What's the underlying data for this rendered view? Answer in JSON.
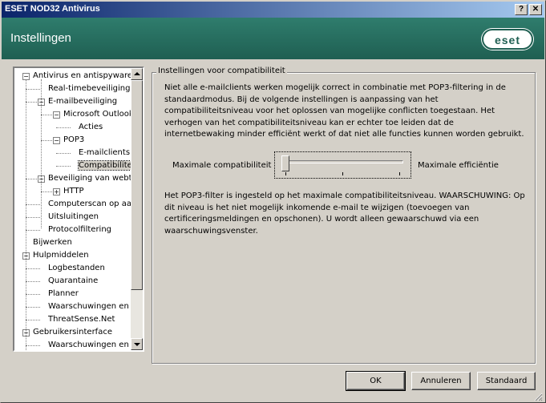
{
  "window": {
    "title": "ESET NOD32 Antivirus",
    "help_button": "?",
    "close_button": "✕"
  },
  "header": {
    "title": "Instellingen",
    "logo": "eset"
  },
  "tree": {
    "items": [
      {
        "label": "Antivirus en antispyware",
        "level": 0,
        "expander": "−"
      },
      {
        "label": "Real-timebeveiliging v",
        "level": 1,
        "expander": ""
      },
      {
        "label": "E-mailbeveiliging",
        "level": 1,
        "expander": "−"
      },
      {
        "label": "Microsoft Outlook",
        "level": 2,
        "expander": "−"
      },
      {
        "label": "Acties",
        "level": 3,
        "expander": ""
      },
      {
        "label": "POP3",
        "level": 2,
        "expander": "−"
      },
      {
        "label": "E-mailclients",
        "level": 3,
        "expander": ""
      },
      {
        "label": "Compatibiliteit",
        "level": 3,
        "expander": "",
        "selected": true
      },
      {
        "label": "Beveiliging van webtc",
        "level": 1,
        "expander": "−"
      },
      {
        "label": "HTTP",
        "level": 2,
        "expander": "+"
      },
      {
        "label": "Computerscan op aan",
        "level": 1,
        "expander": ""
      },
      {
        "label": "Uitsluitingen",
        "level": 1,
        "expander": ""
      },
      {
        "label": "Protocolfiltering",
        "level": 1,
        "expander": ""
      },
      {
        "label": "Bijwerken",
        "level": 0,
        "expander": ""
      },
      {
        "label": "Hulpmiddelen",
        "level": 0,
        "expander": "−"
      },
      {
        "label": "Logbestanden",
        "level": 1,
        "expander": ""
      },
      {
        "label": "Quarantaine",
        "level": 1,
        "expander": ""
      },
      {
        "label": "Planner",
        "level": 1,
        "expander": ""
      },
      {
        "label": "Waarschuwingen en m",
        "level": 1,
        "expander": ""
      },
      {
        "label": "ThreatSense.Net",
        "level": 1,
        "expander": ""
      },
      {
        "label": "Gebruikersinterface",
        "level": 0,
        "expander": "−"
      },
      {
        "label": "Waarschuwingen en m",
        "level": 1,
        "expander": ""
      }
    ]
  },
  "panel": {
    "group_title": "Instellingen voor compatibiliteit",
    "description": "Niet alle e-mailclients werken mogelijk correct in combinatie met POP3-filtering in de standaardmodus. Bij de volgende instellingen is aanpassing van het compatibiliteitsniveau voor het oplossen van mogelijke conflicten toegestaan. Het verhogen van het compatibiliteitsniveau kan er echter toe leiden dat de internetbewaking minder efficiënt werkt of dat niet alle functies kunnen worden gebruikt.",
    "slider_left_label": "Maximale compatibiliteit",
    "slider_right_label": "Maximale efficiëntie",
    "slider_level": 0,
    "note": "Het POP3-filter is ingesteld op het maximale compatibiliteitsniveau. WAARSCHUWING: Op dit niveau is het niet mogelijk inkomende e-mail te wijzigen (toevoegen van certificeringsmeldingen en opschonen). U wordt alleen gewaarschuwd via een waarschuwingsvenster."
  },
  "buttons": {
    "ok": "OK",
    "cancel": "Annuleren",
    "default": "Standaard"
  }
}
